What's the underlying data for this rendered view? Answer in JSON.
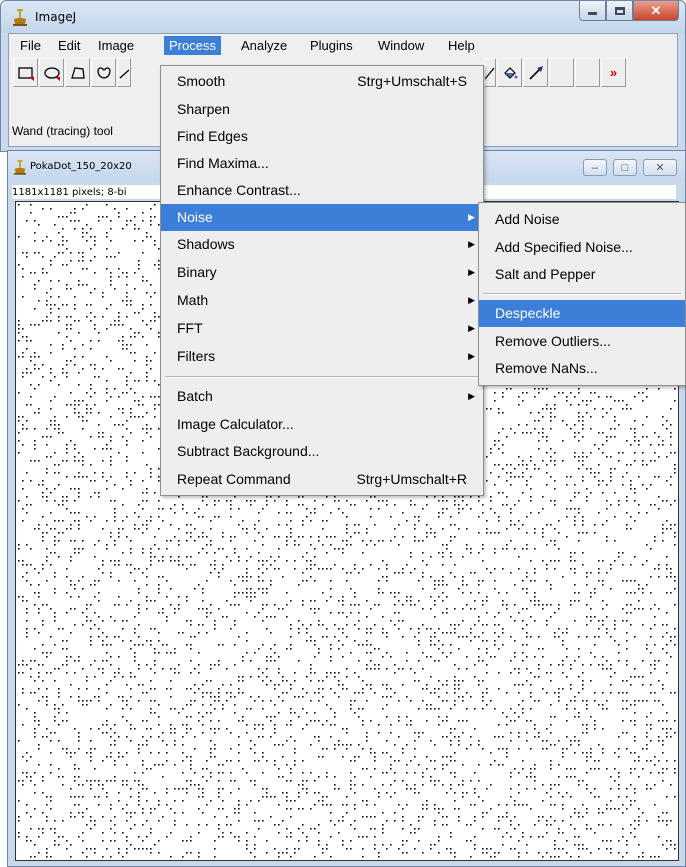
{
  "window": {
    "title": "ImageJ"
  },
  "menubar": [
    "File",
    "Edit",
    "Image",
    "Process",
    "Analyze",
    "Plugins",
    "Window",
    "Help"
  ],
  "active_menu": "Process",
  "toolbar": {
    "more_label": "»"
  },
  "status_text": "Wand (tracing) tool",
  "image_window": {
    "title": "PokaDot_150_20x20",
    "info": "1181x1181 pixels; 8-bi"
  },
  "process_menu": {
    "items": [
      {
        "label": "Smooth",
        "shortcut": "Strg+Umschalt+S"
      },
      {
        "label": "Sharpen"
      },
      {
        "label": "Find Edges"
      },
      {
        "label": "Find Maxima..."
      },
      {
        "label": "Enhance Contrast..."
      },
      {
        "label": "Noise",
        "submenu": true
      },
      {
        "label": "Shadows",
        "submenu": true
      },
      {
        "label": "Binary",
        "submenu": true
      },
      {
        "label": "Math",
        "submenu": true
      },
      {
        "label": "FFT",
        "submenu": true
      },
      {
        "label": "Filters",
        "submenu": true
      },
      {
        "label": "Batch",
        "submenu": true
      },
      {
        "label": "Image Calculator..."
      },
      {
        "label": "Subtract Background..."
      },
      {
        "label": "Repeat Command",
        "shortcut": "Strg+Umschalt+R"
      }
    ]
  },
  "noise_submenu": {
    "items": [
      {
        "label": "Add Noise"
      },
      {
        "label": "Add Specified Noise..."
      },
      {
        "label": "Salt and Pepper"
      },
      {
        "label": "Despeckle"
      },
      {
        "label": "Remove Outliers..."
      },
      {
        "label": "Remove NaNs..."
      }
    ]
  },
  "colors": {
    "highlight": "#3c7fd8",
    "menu_bg": "#eeeeee",
    "frame": "#c9d9ec"
  }
}
